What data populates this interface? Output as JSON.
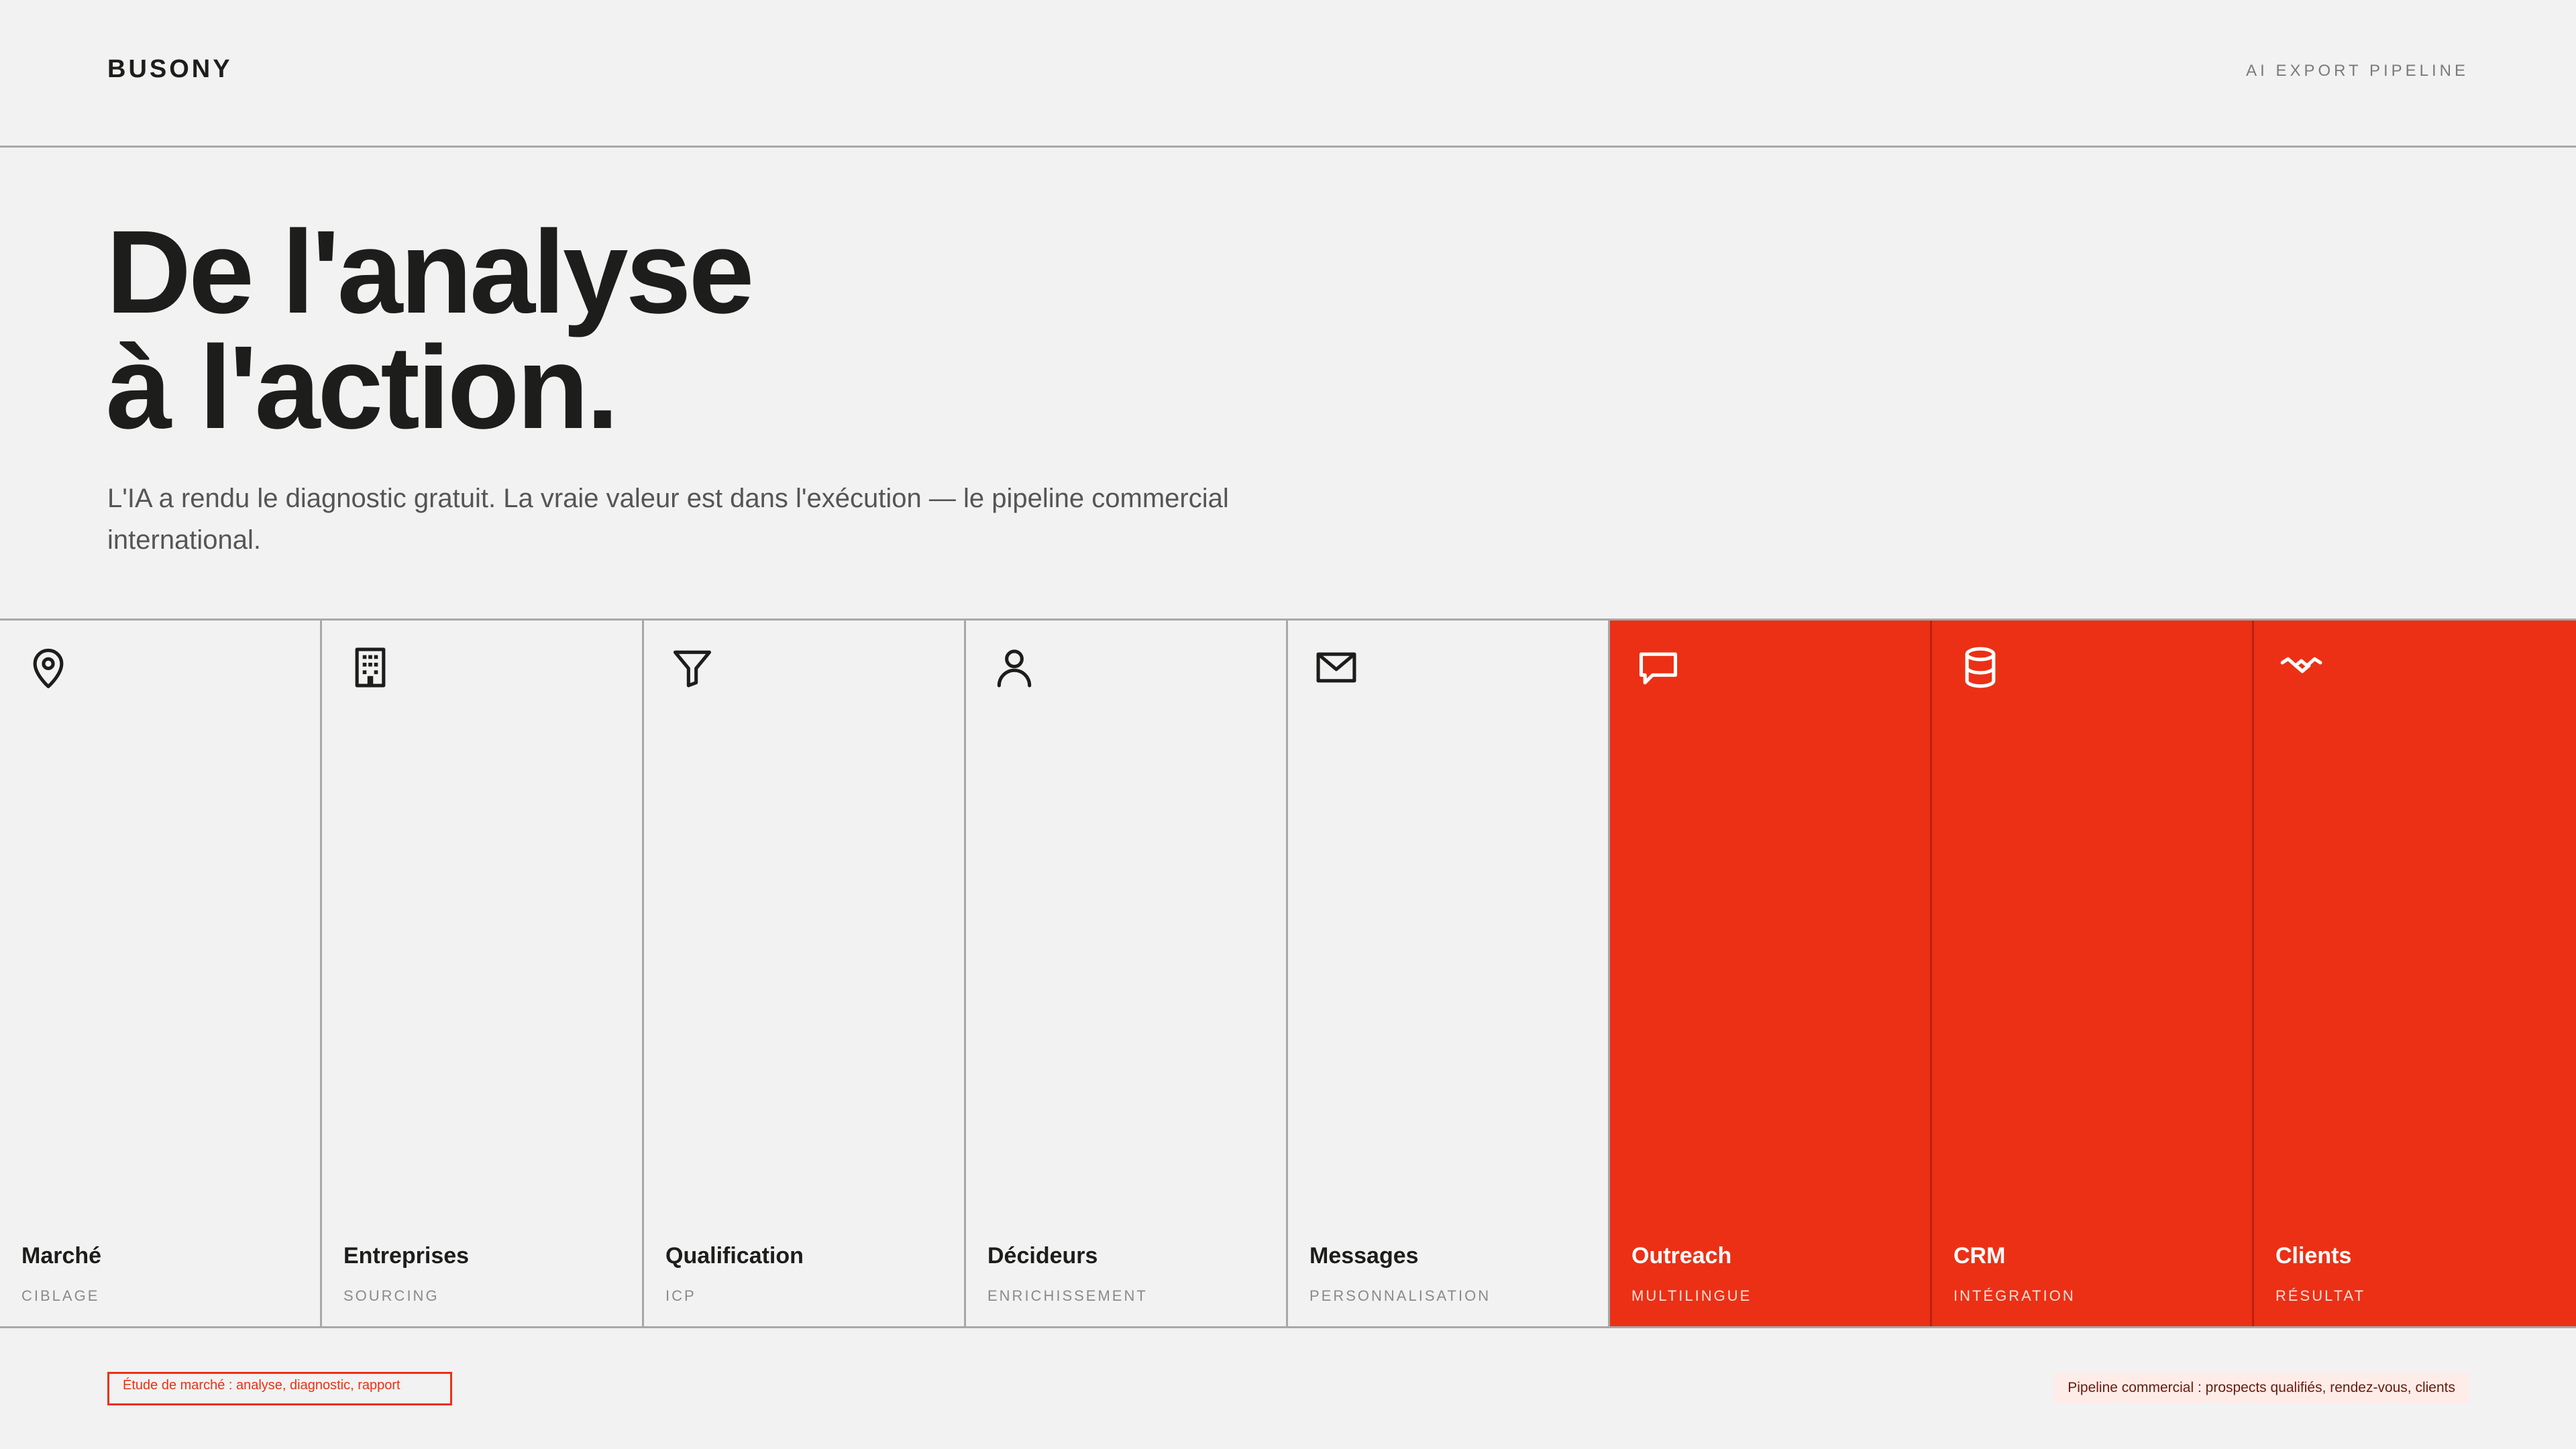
{
  "header": {
    "brand": "BUSONY",
    "tag": "AI EXPORT PIPELINE"
  },
  "hero": {
    "title_line1": "De l'analyse",
    "title_line2": "à l'action.",
    "subtitle": "L'IA a rendu le diagnostic gratuit. La vraie valeur est dans l'exécution — le pipeline commercial international."
  },
  "pipeline": {
    "stages": [
      {
        "name": "Marché",
        "sub": "CIBLAGE",
        "icon": "map-pin-icon",
        "highlight": false
      },
      {
        "name": "Entreprises",
        "sub": "SOURCING",
        "icon": "building-icon",
        "highlight": false
      },
      {
        "name": "Qualification",
        "sub": "ICP",
        "icon": "funnel-icon",
        "highlight": false
      },
      {
        "name": "Décideurs",
        "sub": "ENRICHISSEMENT",
        "icon": "user-icon",
        "highlight": false
      },
      {
        "name": "Messages",
        "sub": "PERSONNALISATION",
        "icon": "envelope-icon",
        "highlight": false
      },
      {
        "name": "Outreach",
        "sub": "MULTILINGUE",
        "icon": "chat-bubble-icon",
        "highlight": true
      },
      {
        "name": "CRM",
        "sub": "INTÉGRATION",
        "icon": "database-icon",
        "highlight": true
      },
      {
        "name": "Clients",
        "sub": "RÉSULTAT",
        "icon": "handshake-icon",
        "highlight": true
      }
    ]
  },
  "notes": {
    "left": "Étude de marché : analyse, diagnostic, rapport",
    "right": "Pipeline commercial : prospects qualifiés, rendez-vous, clients"
  },
  "colors": {
    "accent": "#ec3015",
    "background": "#f2f2f2",
    "text": "#1d1d1b"
  }
}
